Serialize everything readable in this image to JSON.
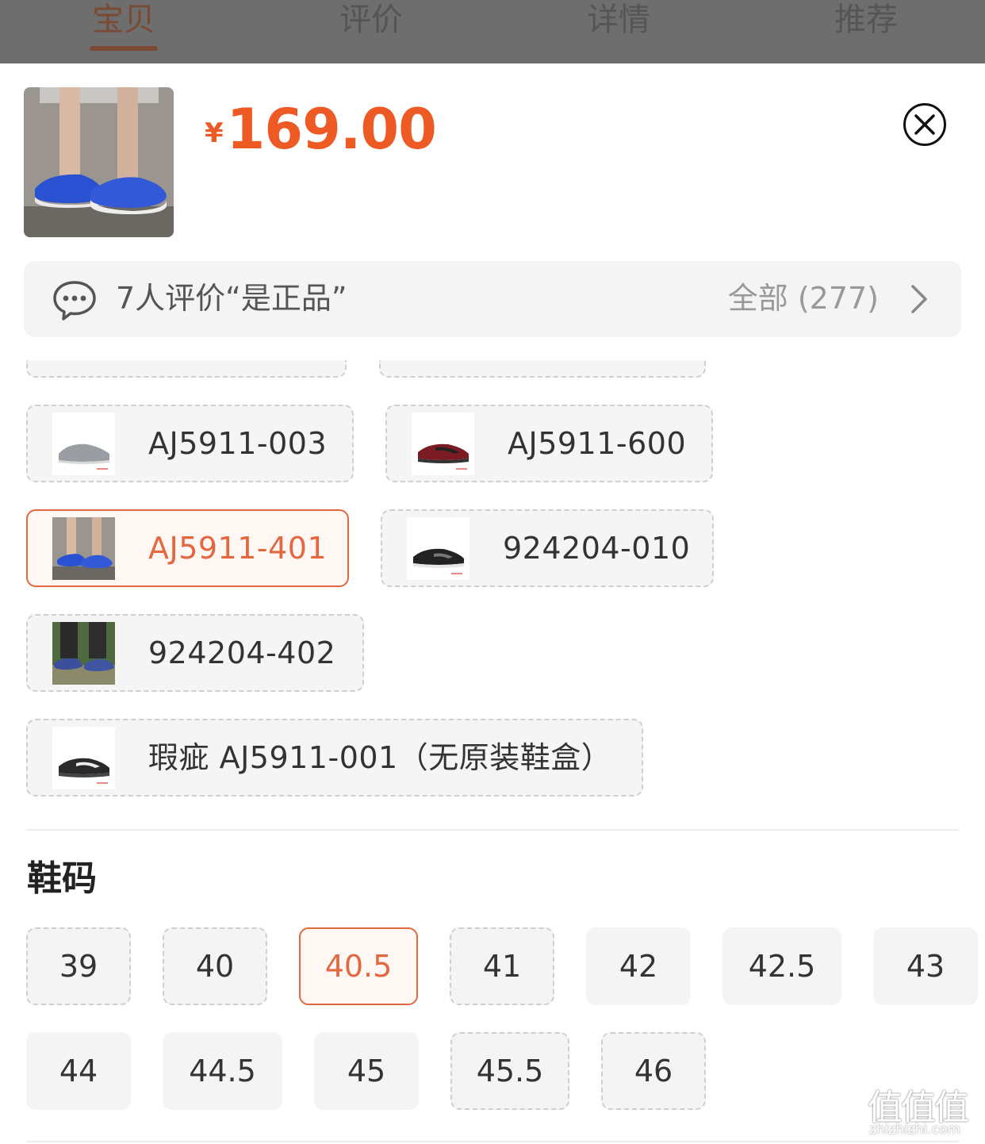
{
  "tabs": [
    {
      "label": "宝贝",
      "active": true
    },
    {
      "label": "评价",
      "active": false
    },
    {
      "label": "详情",
      "active": false
    },
    {
      "label": "推荐",
      "active": false
    }
  ],
  "product": {
    "currency_symbol": "¥",
    "price": "169.00"
  },
  "review": {
    "summary": "7人评价“是正品”",
    "all_label": "全部 (277)"
  },
  "options": [
    {
      "label": "AJ5911-003",
      "selected": false,
      "thumb_color": "#9a9ea3",
      "dashed": true
    },
    {
      "label": "AJ5911-600",
      "selected": false,
      "thumb_color": "#7b1c25",
      "dashed": true
    },
    {
      "label": "AJ5911-401",
      "selected": true,
      "thumb_color": "#2f57d4",
      "dashed": false
    },
    {
      "label": "924204-010",
      "selected": false,
      "thumb_color": "#222222",
      "dashed": true
    },
    {
      "label": "924204-402",
      "selected": false,
      "thumb_color": "#3b4f9a",
      "dashed": true
    },
    {
      "label": "瑕疵 AJ5911-001（无原装鞋盒）",
      "selected": false,
      "thumb_color": "#2a2a2a",
      "dashed": true
    }
  ],
  "size_section": {
    "title": "鞋码",
    "sizes": [
      {
        "label": "39",
        "state": "unavailable"
      },
      {
        "label": "40",
        "state": "unavailable"
      },
      {
        "label": "40.5",
        "state": "selected"
      },
      {
        "label": "41",
        "state": "unavailable"
      },
      {
        "label": "42",
        "state": "available"
      },
      {
        "label": "42.5",
        "state": "available"
      },
      {
        "label": "43",
        "state": "available"
      },
      {
        "label": "44",
        "state": "available"
      },
      {
        "label": "44.5",
        "state": "available"
      },
      {
        "label": "45",
        "state": "available"
      },
      {
        "label": "45.5",
        "state": "unavailable"
      },
      {
        "label": "46",
        "state": "unavailable"
      }
    ]
  },
  "watermark": {
    "glyphs": "值值值",
    "url": "zhizhizhi.com"
  },
  "colors": {
    "accent": "#e3683f",
    "price": "#ee5a24"
  }
}
